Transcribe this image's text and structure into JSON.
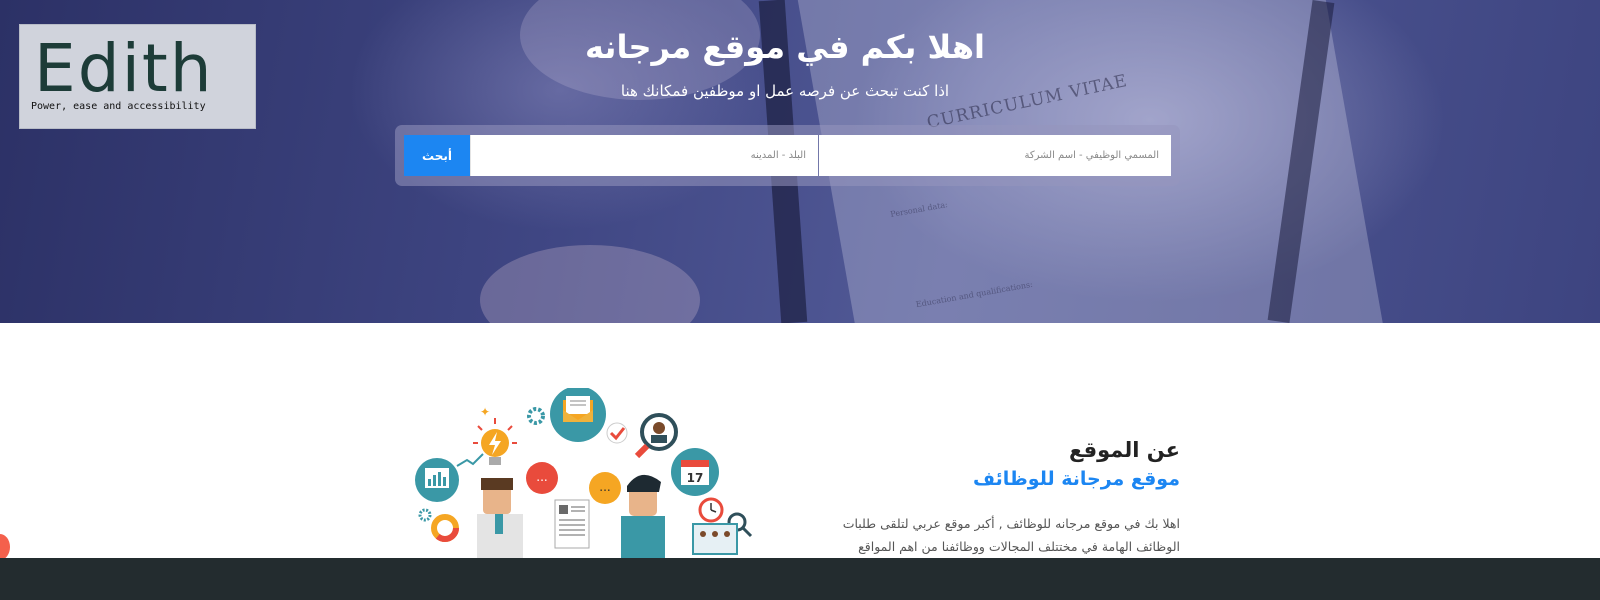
{
  "logo": {
    "name": "Edith",
    "tagline": "Power, ease and accessibility"
  },
  "hero": {
    "title": "اهلا بكم في موقع مرجانه",
    "subtitle": "اذا كنت تبحث عن فرصه عمل او موظفين فمكانك هنا",
    "background_text": "CURRICULUM VITAE",
    "background_small_1": "Personal data:",
    "background_small_2": "Education and qualifications:"
  },
  "search": {
    "title_placeholder": "المسمي الوظيفي - اسم الشركة",
    "city_placeholder": "البلد - المدينه",
    "button_label": "أبحث"
  },
  "about": {
    "heading": "عن الموقع",
    "subheading": "موقع مرجانة للوظائف",
    "body": "اهلا بك في موقع مرجانه للوظائف , أكبر موقع عربي لتلقى طلبات الوظائف الهامة في مختتلف المجالات ووظائفنا من اهم المواقع"
  },
  "illustration": {
    "calendar_day": "17",
    "chat_dots": "...",
    "icons": [
      "lightbulb-icon",
      "gear-icon",
      "envelope-icon",
      "checkmark-icon",
      "user-search-icon",
      "calendar-icon",
      "clock-icon",
      "magnifier-icon",
      "bar-chart-icon",
      "donut-chart-icon",
      "chat-bubble-icon",
      "resume-icon"
    ]
  },
  "colors": {
    "accent": "#1c86f2",
    "logo_text": "#1d3c38",
    "footer": "#232c2f"
  }
}
